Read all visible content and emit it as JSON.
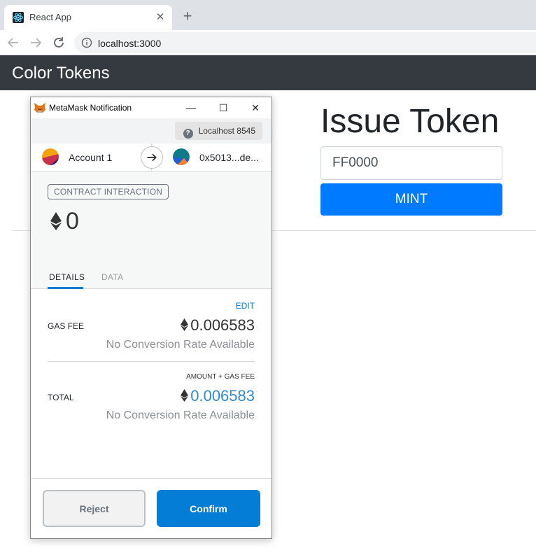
{
  "browser": {
    "tab_title": "React App",
    "url": "localhost:3000"
  },
  "app": {
    "brand": "Color Tokens",
    "issue_title": "Issue Token",
    "token_input_value": "FF0000",
    "mint_label": "MINT",
    "colors": {
      "navbar": "#343a40",
      "primary": "#007bff"
    }
  },
  "metamask": {
    "window_title": "MetaMask Notification",
    "network": "Localhost 8545",
    "from_account": "Account 1",
    "to_address": "0x5013...de...",
    "badge": "CONTRACT INTERACTION",
    "amount": "0",
    "tabs": {
      "details": "DETAILS",
      "data": "DATA"
    },
    "edit_label": "EDIT",
    "gas_fee_label": "GAS FEE",
    "gas_fee_value": "0.006583",
    "gas_fee_conversion": "No Conversion Rate Available",
    "amount_gas_label": "AMOUNT + GAS FEE",
    "total_label": "TOTAL",
    "total_value": "0.006583",
    "total_conversion": "No Conversion Rate Available",
    "reject_label": "Reject",
    "confirm_label": "Confirm",
    "colors": {
      "accent": "#037dd6",
      "total": "#2f8ad1"
    }
  }
}
